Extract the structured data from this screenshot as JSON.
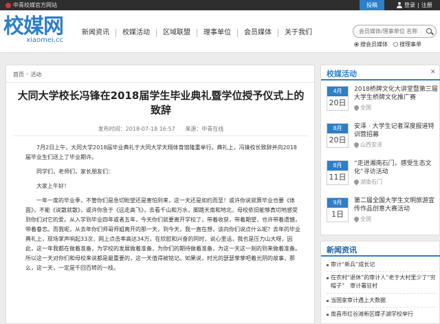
{
  "topbar": {
    "site_name": "中青校媒官方网站",
    "contribute": "投稿",
    "login": "登录",
    "divider": "|",
    "register": "注册"
  },
  "header": {
    "logo_cn": "校媒网",
    "logo_en": "xiaomei.cc",
    "nav": [
      "新闻资讯",
      "校媒活动",
      "区域联盟",
      "理事单位",
      "会员媒体",
      "关于我们"
    ],
    "search_placeholder": "会员媒体/理事单位 名称",
    "radios": [
      {
        "label": "搜会员媒体",
        "checked": true
      },
      {
        "label": "搜理事单",
        "checked": false
      }
    ]
  },
  "breadcrumb": {
    "home": "首页",
    "sep": "›",
    "section": "活动"
  },
  "article": {
    "title": "大同大学校长冯锋在2018届学生毕业典礼暨学位授予仪式上的致辞",
    "time_label": "发布时间：2018-07-18 16:57",
    "source_label": "来源：中青在线",
    "paragraphs": [
      "7月2日上午，大同大学2018届毕业典礼于大同大学天翔体育馆隆重举行。典礼上，冯锋校长致辞并向2018届毕业生们送上了毕业期许。",
      "同学们，老师们，家长朋友们：",
      "大家上午好！",
      "一年一度的毕业季，不管你们是急切盼望还是害怕到来，这一天还是如约而至！或许你说就算毕业也要《体面》，不能《说散就散》，或许你急于《远走高飞》，去看千山和万水，脚踏天南和地北，母校依旧能够真切地感受到你们对它的爱。从入学到毕业四年或者五年，今天你们就要离开学校了，带着收获，带着期望，也许带着遗憾，带着眷恋。而我呢，从去年你们师哥师姐离开的那一天，到今天，我一直在想，该向你们说点什么呢？去年的毕业典礼上，现场掌声响起33次，网上点击率高达34万，在欣慰和兴奋的同时，说心里话，我也是压力山大呀，因此，这一年我都在做着准备，为学校的发展做着准备，为你们的期待做着准备，为这一天这一刻的到来做着准备。所以这一天对你们和母校来说都是最重要的，这一天值得被铭记。如果说，时光的瑟瑟孳孳吧着光阴的故事，那么，这一天，一定是千回百转的一枝。"
    ]
  },
  "sidebar_events": {
    "heading": "校媒活动",
    "items": [
      {
        "month": "4月",
        "day": "20日",
        "text": "2018桥牌文化大讲堂暨第三届大学生桥牌文化推广赛",
        "loc": "全国"
      },
      {
        "month": "8月",
        "day": "20日",
        "text": "安泽 · 大学生记者深度报道特训营招募",
        "loc": "山西安泽"
      },
      {
        "month": "8月",
        "day": "11日",
        "text": "“走进湘南石门，感受生态文化”寻访活动",
        "loc": "湖南石门"
      },
      {
        "month": "9月",
        "day": "1日",
        "text": "第二届全国大学生文明旅游宣传作品创意大赛活动",
        "loc": "全国"
      }
    ]
  },
  "sidebar_news": {
    "heading": "新闻资讯",
    "items": [
      "审计“新兵”成长记",
      "在农村“退休”的审计人“老于大村里少了“穷帽子”　审计署驻村",
      "当国家审计遇上大数据",
      "南昌市红谷滩新区蝶子湖学校举行"
    ]
  },
  "close_glyph": "✕",
  "colors": {
    "brand": "#2c7fc8",
    "topbar": "#2e2e2e"
  }
}
